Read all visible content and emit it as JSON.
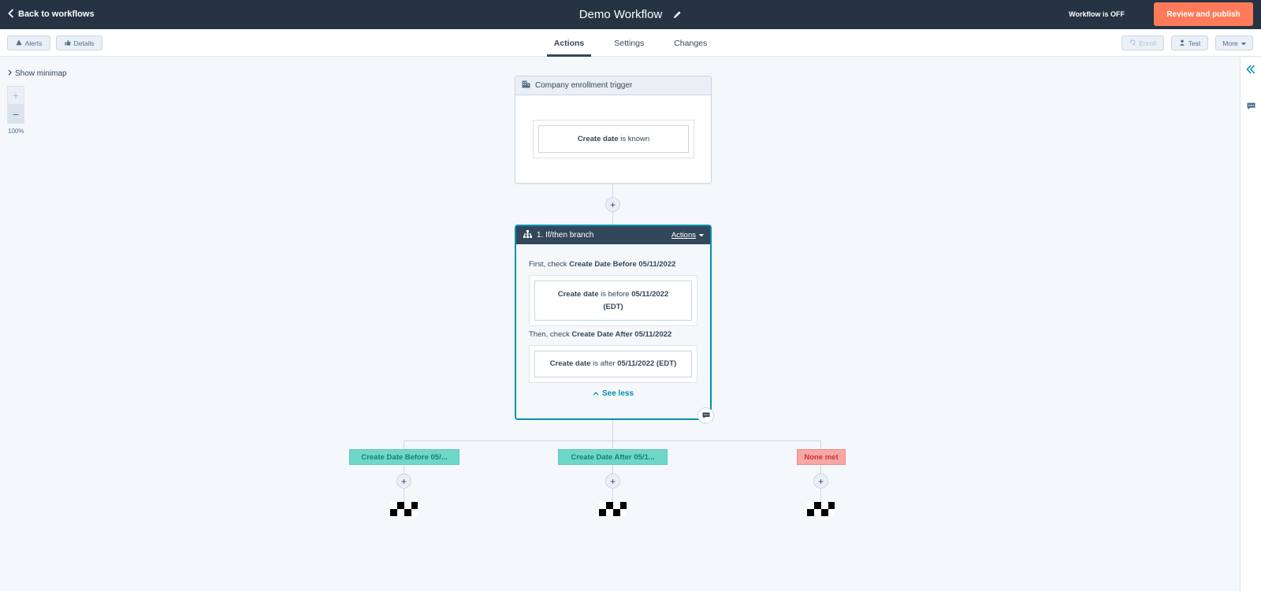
{
  "colors": {
    "topbar": "#253342",
    "accent": "#ff7a59",
    "teal": "#0091ae",
    "branch_green": "#6fd7c9",
    "branch_red": "#f8a7a4"
  },
  "topbar": {
    "back_label": "Back to workflows",
    "title": "Demo Workflow",
    "status": "Workflow is OFF",
    "publish_label": "Review and publish"
  },
  "subbar": {
    "alerts_label": "Alerts",
    "details_label": "Details",
    "tabs": [
      {
        "label": "Actions",
        "active": true
      },
      {
        "label": "Settings",
        "active": false
      },
      {
        "label": "Changes",
        "active": false
      }
    ],
    "enroll_label": "Enroll",
    "test_label": "Test",
    "more_label": "More"
  },
  "canvas": {
    "minimap_label": "Show minimap",
    "zoom_in": "+",
    "zoom_out": "−",
    "zoom_level": "100%",
    "plus": "+"
  },
  "trigger": {
    "title": "Company enrollment trigger",
    "condition_property": "Create date",
    "condition_operator": "is known"
  },
  "branch": {
    "title": "1. If/then branch",
    "actions_label": "Actions",
    "first_prefix": "First, check",
    "first_name": "Create Date Before 05/11/2022",
    "first_property": "Create date",
    "first_operator": "is before",
    "first_value": "05/11/2022",
    "first_tz": "(EDT)",
    "then_prefix": "Then, check",
    "then_name": "Create Date After 05/11/2022",
    "then_property": "Create date",
    "then_operator": "is after",
    "then_value": "05/11/2022 (EDT)",
    "see_less": "See less"
  },
  "branches": [
    {
      "label": "Create Date Before 05/...",
      "kind": "green"
    },
    {
      "label": "Create Date After 05/1...",
      "kind": "green"
    },
    {
      "label": "None met",
      "kind": "red"
    }
  ]
}
